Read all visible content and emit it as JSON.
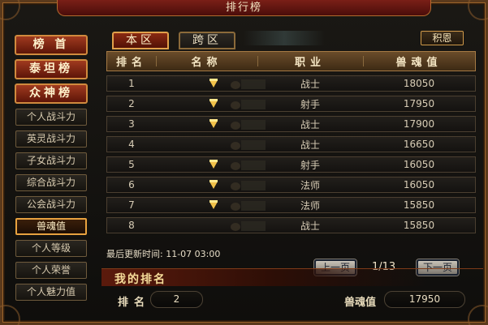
{
  "window": {
    "title": "排行榜"
  },
  "sidebar": {
    "big": [
      "榜 首",
      "泰坦榜",
      "众神榜"
    ],
    "small": [
      {
        "label": "个人战斗力",
        "active": false
      },
      {
        "label": "英灵战斗力",
        "active": false
      },
      {
        "label": "子女战斗力",
        "active": false
      },
      {
        "label": "综合战斗力",
        "active": false
      },
      {
        "label": "公会战斗力",
        "active": false
      },
      {
        "label": "兽魂值",
        "active": true
      },
      {
        "label": "个人等级",
        "active": false
      },
      {
        "label": "个人荣誉",
        "active": false
      },
      {
        "label": "个人魅力值",
        "active": false
      }
    ]
  },
  "tabs": {
    "local": "本区",
    "cross": "跨区"
  },
  "points_button": "积恩",
  "table": {
    "headers": [
      "排名",
      "名称",
      "职业",
      "兽魂值"
    ],
    "rows": [
      {
        "rank": "1",
        "job": "战士",
        "value": "18050",
        "gem": true
      },
      {
        "rank": "2",
        "job": "射手",
        "value": "17950",
        "gem": true
      },
      {
        "rank": "3",
        "job": "战士",
        "value": "17900",
        "gem": true
      },
      {
        "rank": "4",
        "job": "战士",
        "value": "16650",
        "gem": false
      },
      {
        "rank": "5",
        "job": "射手",
        "value": "16050",
        "gem": true
      },
      {
        "rank": "6",
        "job": "法师",
        "value": "16050",
        "gem": true
      },
      {
        "rank": "7",
        "job": "法师",
        "value": "15850",
        "gem": true
      },
      {
        "rank": "8",
        "job": "战士",
        "value": "15850",
        "gem": false
      }
    ]
  },
  "update": {
    "label": "最后更新时间:",
    "time": "11-07 03:00"
  },
  "pager": {
    "prev": "上一页",
    "page": "1/13",
    "next": "下一页"
  },
  "my_rank": {
    "title": "我的排名",
    "rank_label": "排名",
    "rank_value": "2",
    "value_label": "兽魂值",
    "value": "17950"
  }
}
